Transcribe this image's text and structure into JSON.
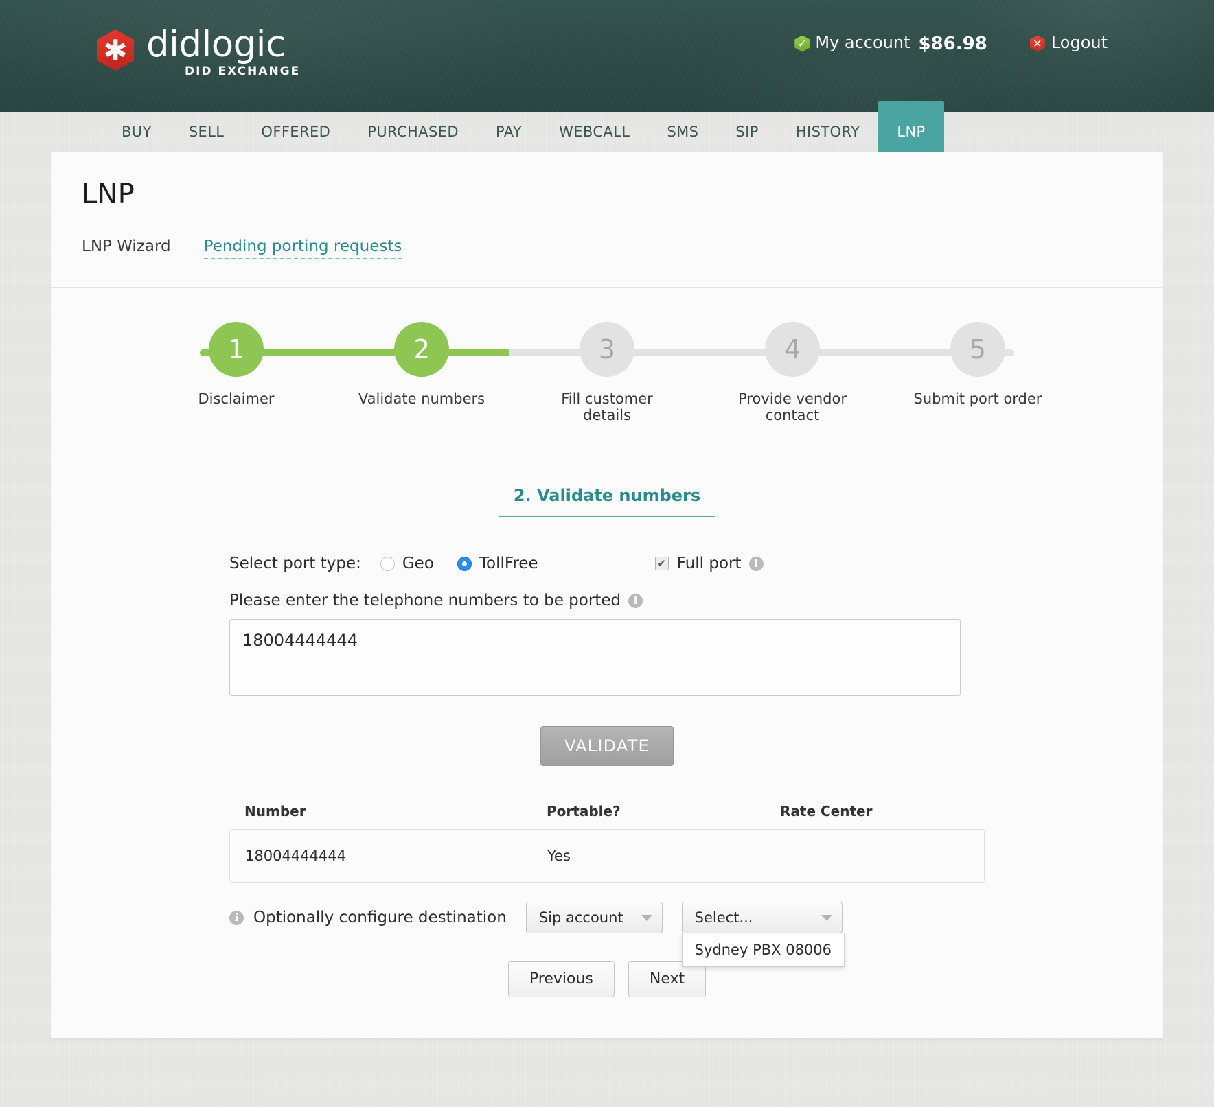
{
  "header": {
    "logo_name": "didlogic",
    "logo_sub": "DID EXCHANGE",
    "account_label": "My account",
    "balance": "$86.98",
    "logout_label": "Logout",
    "check_glyph": "✓",
    "x_glyph": "✕",
    "asterisk_glyph": "✱"
  },
  "nav": {
    "items": [
      {
        "label": "BUY",
        "active": false
      },
      {
        "label": "SELL",
        "active": false
      },
      {
        "label": "OFFERED",
        "active": false
      },
      {
        "label": "PURCHASED",
        "active": false
      },
      {
        "label": "PAY",
        "active": false
      },
      {
        "label": "WEBCALL",
        "active": false
      },
      {
        "label": "SMS",
        "active": false
      },
      {
        "label": "SIP",
        "active": false
      },
      {
        "label": "HISTORY",
        "active": false
      },
      {
        "label": "LNP",
        "active": true
      }
    ]
  },
  "page": {
    "title": "LNP",
    "subtabs": [
      {
        "label": "LNP Wizard",
        "style": "plain"
      },
      {
        "label": "Pending porting requests",
        "style": "link"
      }
    ]
  },
  "stepper": {
    "progress_percent": 38,
    "steps": [
      {
        "number": "1",
        "label": "Disclaimer",
        "done": true
      },
      {
        "number": "2",
        "label": "Validate numbers",
        "done": true
      },
      {
        "number": "3",
        "label": "Fill customer details",
        "done": false
      },
      {
        "number": "4",
        "label": "Provide vendor contact",
        "done": false
      },
      {
        "number": "5",
        "label": "Submit port order",
        "done": false
      }
    ]
  },
  "form": {
    "section_title": "2. Validate numbers",
    "port_type_label": "Select port type:",
    "port_type_options": [
      {
        "label": "Geo",
        "selected": false
      },
      {
        "label": "TollFree",
        "selected": true
      }
    ],
    "full_port_label": "Full port",
    "full_port_checked": true,
    "check_glyph": "✔",
    "info_glyph": "i",
    "numbers_label": "Please enter the telephone numbers to be ported",
    "numbers_value": "18004444444",
    "numbers_placeholder": "",
    "validate_button": "VALIDATE"
  },
  "results": {
    "columns": [
      "Number",
      "Portable?",
      "Rate Center"
    ],
    "rows": [
      {
        "number": "18004444444",
        "portable": "Yes",
        "rate_center": ""
      }
    ]
  },
  "destination": {
    "label": "Optionally configure destination",
    "type_select_value": "Sip account",
    "account_select_value": "Select...",
    "account_options": [
      "Sydney PBX 08006"
    ]
  },
  "footer_buttons": {
    "previous": "Previous",
    "next": "Next"
  },
  "colors": {
    "header_bg": "#2e4c48",
    "accent_teal": "#2a8c8c",
    "tab_active": "#4aa5a2",
    "step_done": "#8dc653",
    "radio_selected": "#2b8cf0",
    "logo_red": "#cf2b23"
  }
}
